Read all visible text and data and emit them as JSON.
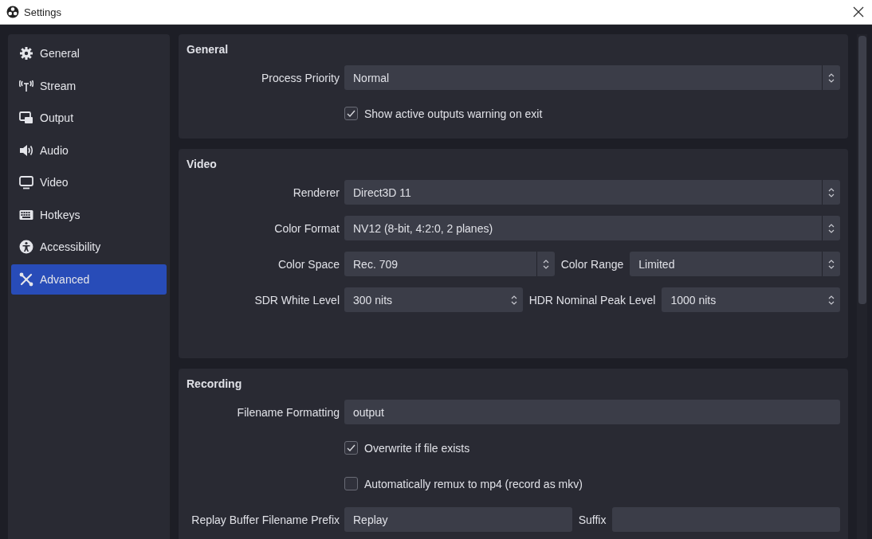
{
  "window": {
    "title": "Settings"
  },
  "sidebar": {
    "items": [
      {
        "label": "General",
        "selected": false
      },
      {
        "label": "Stream",
        "selected": false
      },
      {
        "label": "Output",
        "selected": false
      },
      {
        "label": "Audio",
        "selected": false
      },
      {
        "label": "Video",
        "selected": false
      },
      {
        "label": "Hotkeys",
        "selected": false
      },
      {
        "label": "Accessibility",
        "selected": false
      },
      {
        "label": "Advanced",
        "selected": true
      }
    ]
  },
  "sections": [
    {
      "title": "General",
      "rows": [
        {
          "kind": "select",
          "label": "Process Priority",
          "value": "Normal"
        },
        {
          "kind": "checkbox",
          "label": "Show active outputs warning on exit",
          "checked": true
        }
      ]
    },
    {
      "title": "Video",
      "rows": [
        {
          "kind": "select",
          "label": "Renderer",
          "value": "Direct3D 11"
        },
        {
          "kind": "select",
          "label": "Color Format",
          "value": "NV12 (8-bit, 4:2:0, 2 planes)"
        },
        {
          "kind": "pair",
          "fields": [
            {
              "kind": "select",
              "label": "Color Space",
              "value": "Rec. 709"
            },
            {
              "kind": "select",
              "label": "Color Range",
              "value": "Limited"
            }
          ]
        },
        {
          "kind": "pair",
          "fields": [
            {
              "kind": "spin",
              "label": "SDR White Level",
              "value": "300 nits"
            },
            {
              "kind": "spin",
              "label": "HDR Nominal Peak Level",
              "value": "1000 nits"
            }
          ]
        }
      ]
    },
    {
      "title": "Recording",
      "rows": [
        {
          "kind": "text",
          "label": "Filename Formatting",
          "value": "output"
        },
        {
          "kind": "checkbox",
          "label": "Overwrite if file exists",
          "checked": true
        },
        {
          "kind": "checkbox",
          "label": "Automatically remux to mp4 (record as mkv)",
          "checked": false
        },
        {
          "kind": "pair",
          "fields": [
            {
              "kind": "text",
              "label": "Replay Buffer Filename Prefix",
              "value": "Replay"
            },
            {
              "kind": "text",
              "label": "Suffix"
            }
          ]
        }
      ]
    }
  ]
}
